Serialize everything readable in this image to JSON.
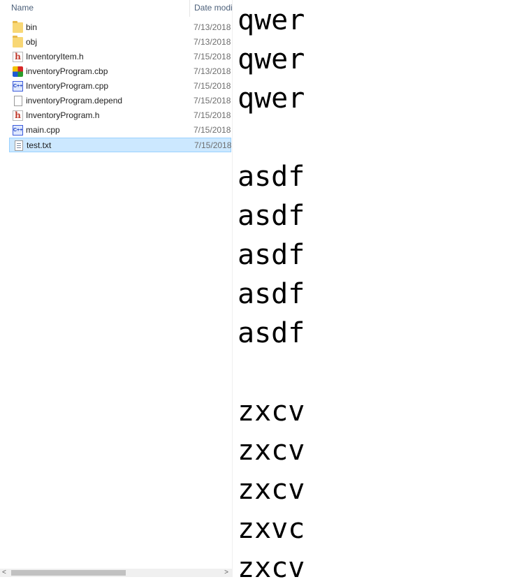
{
  "explorer": {
    "columns": {
      "name": "Name",
      "date": "Date modi"
    },
    "files": [
      {
        "name": "bin",
        "date": "7/13/2018",
        "icon": "folder-icon"
      },
      {
        "name": "obj",
        "date": "7/13/2018",
        "icon": "folder-icon"
      },
      {
        "name": "InventoryItem.h",
        "date": "7/15/2018",
        "icon": "header-file-icon"
      },
      {
        "name": "inventoryProgram.cbp",
        "date": "7/13/2018",
        "icon": "codeblocks-project-icon"
      },
      {
        "name": "InventoryProgram.cpp",
        "date": "7/15/2018",
        "icon": "cpp-file-icon"
      },
      {
        "name": "inventoryProgram.depend",
        "date": "7/15/2018",
        "icon": "blank-file-icon"
      },
      {
        "name": "InventoryProgram.h",
        "date": "7/15/2018",
        "icon": "header-file-icon"
      },
      {
        "name": "main.cpp",
        "date": "7/15/2018",
        "icon": "cpp-file-icon"
      },
      {
        "name": "test.txt",
        "date": "7/15/2018",
        "icon": "text-file-icon",
        "selected": true
      }
    ]
  },
  "editor": {
    "lines": [
      "qwer",
      "qwer",
      "qwer",
      "",
      "asdf",
      "asdf",
      "asdf",
      "asdf",
      "asdf",
      "",
      "zxcv",
      "zxcv",
      "zxcv",
      "zxvc",
      "zxcv"
    ]
  },
  "colors": {
    "selection": "#cce8ff",
    "selection_border": "#99d1ff",
    "folder": "#f8d775"
  }
}
